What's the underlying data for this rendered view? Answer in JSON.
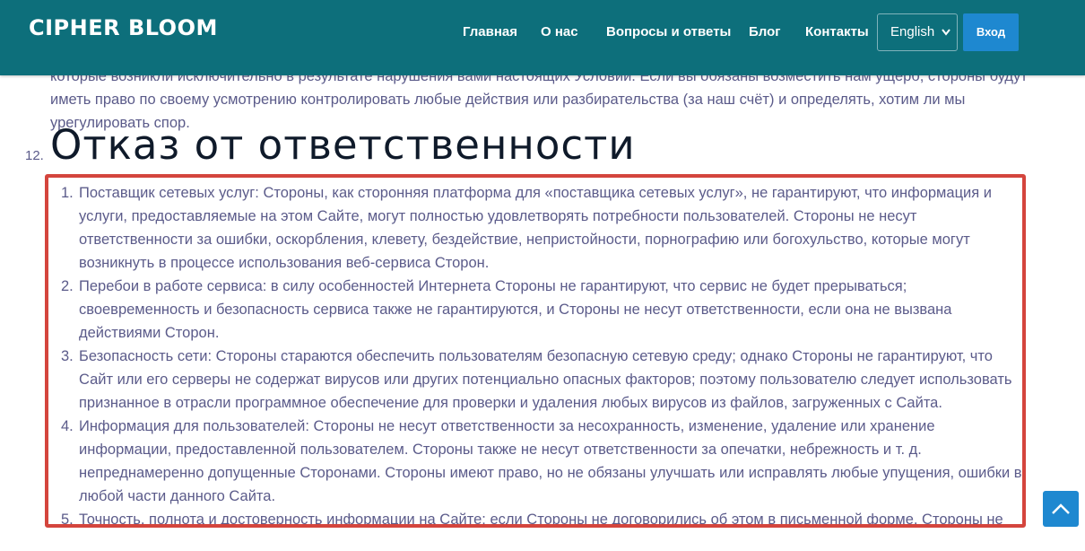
{
  "header": {
    "logo": "CIPHER BLOOM",
    "nav": [
      {
        "label": "Главная"
      },
      {
        "label": "О нас"
      },
      {
        "label": "Вопросы и ответы"
      },
      {
        "label": "Блог"
      },
      {
        "label": "Контакты"
      }
    ],
    "language": "English",
    "login_label": "Вход"
  },
  "content": {
    "prev_paragraph": "которые возникли исключительно в результате нарушения вами настоящих Условий. Если вы обязаны возместить нам ущерб, стороны будут иметь право по своему усмотрению контролировать любые действия или разбирательства (за наш счёт) и определять, хотим ли мы урегулировать спор.",
    "section_number": "12.",
    "section_title": "Отказ от ответственности",
    "items": [
      {
        "num": "1.",
        "text": "Поставщик сетевых услуг: Стороны, как сторонняя платформа для «поставщика сетевых услуг», не гарантируют, что информация и услуги, предоставляемые на этом Сайте, могут полностью удовлетворять потребности пользователей. Стороны не несут ответственности за ошибки, оскорбления, клевету, бездействие, непристойности, порнографию или богохульство, которые могут возникнуть в процессе использования веб-сервиса Сторон."
      },
      {
        "num": "2.",
        "text": "Перебои в работе сервиса: в силу особенностей Интернета Стороны не гарантируют, что сервис не будет прерываться; своевременность и безопасность сервиса также не гарантируются, и Стороны не несут ответственности, если она не вызвана действиями Сторон."
      },
      {
        "num": "3.",
        "text": "Безопасность сети: Стороны стараются обеспечить пользователям безопасную сетевую среду; однако Стороны не гарантируют, что Сайт или его серверы не содержат вирусов или других потенциально опасных факторов; поэтому пользователю следует использовать признанное в отрасли программное обеспечение для проверки и удаления любых вирусов из файлов, загруженных с Сайта."
      },
      {
        "num": "4.",
        "text": "Информация для пользователей: Стороны не несут ответственности за несохранность, изменение, удаление или хранение информации, предоставленной пользователем. Стороны также не несут ответственности за опечатки, небрежность и т. д. непреднамеренно допущенные Сторонами. Стороны имеют право, но не обязаны улучшать или исправлять любые упущения, ошибки в любой части данного Сайта."
      },
      {
        "num": "5.",
        "text": "Точность, полнота и достоверность информации на Сайте: если Стороны не договорились об этом в письменной форме, Стороны не"
      }
    ]
  },
  "icons": {
    "scroll_top": "chevron-up-icon",
    "language_dropdown": "chevron-down-icon"
  },
  "colors": {
    "header_bg": "#0d6f7b",
    "button_blue": "#1e88d0",
    "highlight_border": "#d4453d",
    "body_text": "#5b5b8a",
    "title_text": "#0f1a2a"
  }
}
